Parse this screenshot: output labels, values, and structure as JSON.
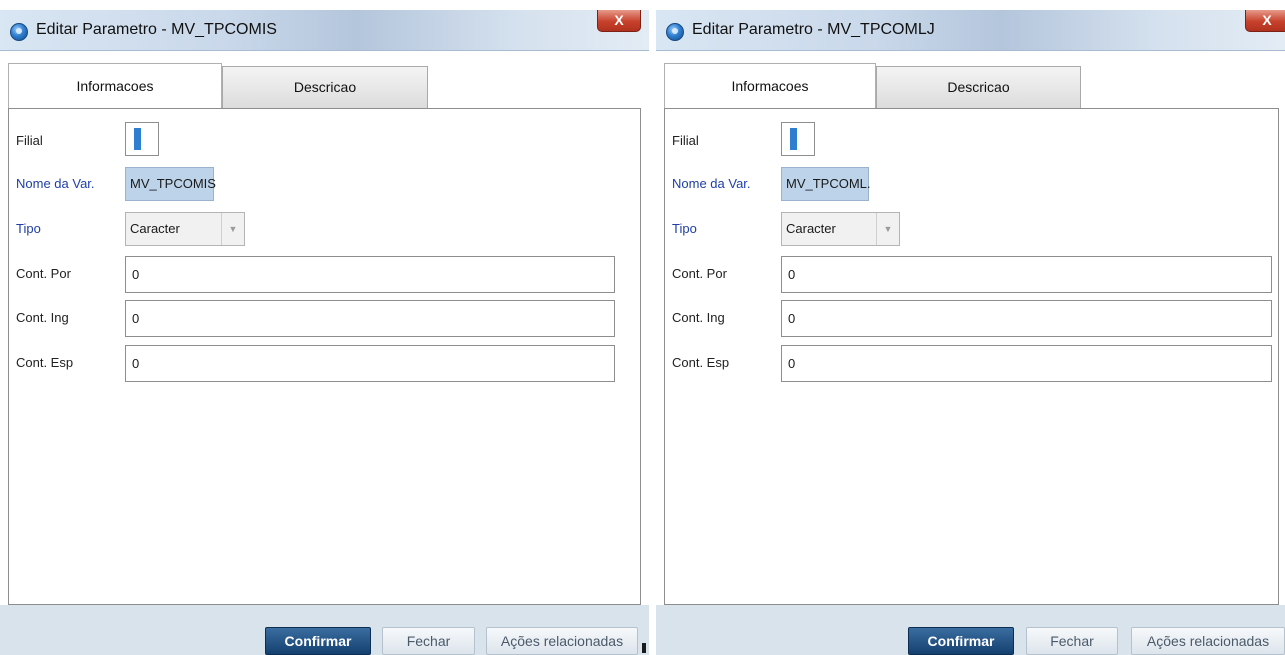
{
  "colors": {
    "label_blue": "#1f3ea8",
    "var_field_bg": "#bcd3ea",
    "primary_button": "#1f4f80",
    "footer_bg": "#d9e3ec",
    "close_button": "#c7412b"
  },
  "dialogs": [
    {
      "title": "Editar Parametro - MV_TPCOMIS",
      "close_label": "X",
      "tabs": [
        {
          "label": "Informacoes",
          "active": true
        },
        {
          "label": "Descricao",
          "active": false
        }
      ],
      "fields": {
        "filial_label": "Filial",
        "filial_value": "",
        "nome_var_label": "Nome da Var.",
        "nome_var_value": "MV_TPCOMIS",
        "tipo_label": "Tipo",
        "tipo_value": "Caracter",
        "cont_por_label": "Cont. Por",
        "cont_por_value": "0",
        "cont_ing_label": "Cont. Ing",
        "cont_ing_value": "0",
        "cont_esp_label": "Cont. Esp",
        "cont_esp_value": "0"
      },
      "buttons": {
        "confirm": "Confirmar",
        "close": "Fechar",
        "actions": "Ações relacionadas"
      }
    },
    {
      "title": "Editar Parametro - MV_TPCOMLJ",
      "close_label": "X",
      "tabs": [
        {
          "label": "Informacoes",
          "active": true
        },
        {
          "label": "Descricao",
          "active": false
        }
      ],
      "fields": {
        "filial_label": "Filial",
        "filial_value": "",
        "nome_var_label": "Nome da Var.",
        "nome_var_value": "MV_TPCOML.",
        "tipo_label": "Tipo",
        "tipo_value": "Caracter",
        "cont_por_label": "Cont. Por",
        "cont_por_value": "0",
        "cont_ing_label": "Cont. Ing",
        "cont_ing_value": "0",
        "cont_esp_label": "Cont. Esp",
        "cont_esp_value": "0"
      },
      "buttons": {
        "confirm": "Confirmar",
        "close": "Fechar",
        "actions": "Ações relacionadas"
      }
    }
  ]
}
